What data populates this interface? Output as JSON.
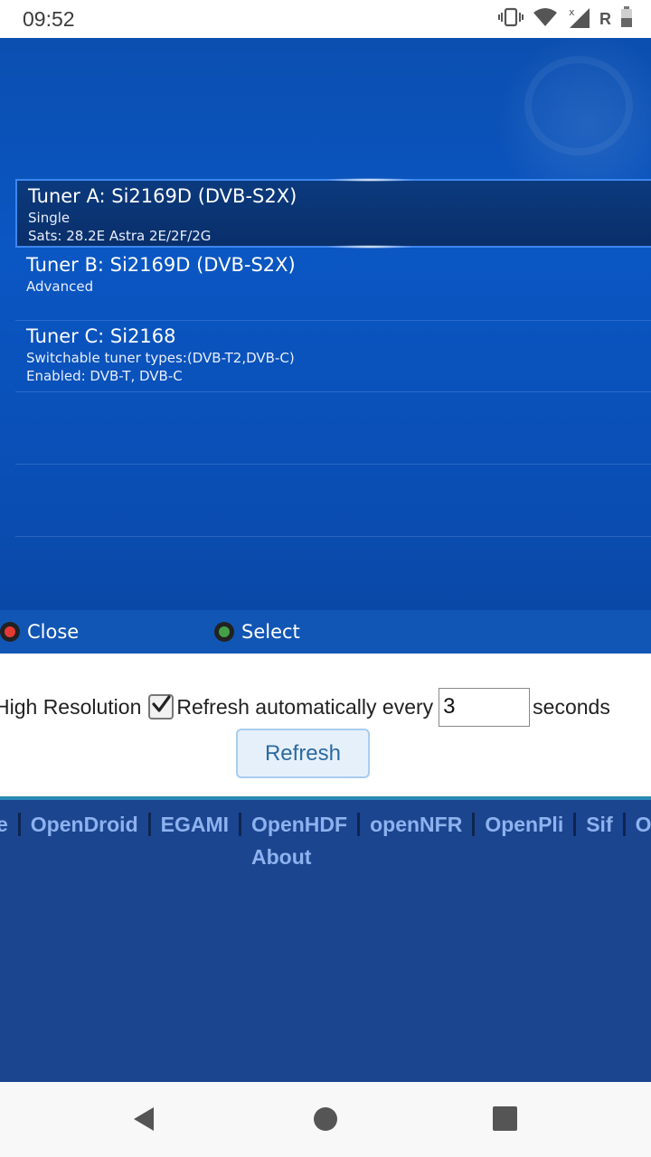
{
  "status_bar": {
    "time": "09:52",
    "roaming_label": "R",
    "icons": [
      "vibrate-icon",
      "wifi-icon",
      "cell-signal-icon",
      "battery-icon"
    ]
  },
  "tv_screen": {
    "tuners": [
      {
        "title": "Tuner A: Si2169D (DVB-S2X)",
        "line1": "Single",
        "line2": "Sats: 28.2E Astra 2E/2F/2G",
        "selected": true
      },
      {
        "title": "Tuner B: Si2169D (DVB-S2X)",
        "line1": "Advanced",
        "line2": ""
      },
      {
        "title": "Tuner C: Si2168",
        "line1": "Switchable tuner types:(DVB-T2,DVB-C)",
        "line2": "Enabled: DVB-T, DVB-C"
      }
    ],
    "buttons": {
      "close_label": "Close",
      "close_color": "#e53935",
      "select_label": "Select",
      "select_color": "#43a047"
    }
  },
  "controls": {
    "high_resolution_label": "High Resolution",
    "auto_refresh_checked": true,
    "auto_refresh_label": "Refresh automatically every",
    "interval_value": "3",
    "seconds_label": "seconds",
    "refresh_button": "Refresh"
  },
  "footer_nav": {
    "links": [
      "e",
      "OpenDroid",
      "EGAMI",
      "OpenHDF",
      "openNFR",
      "OpenPli",
      "Sif",
      "Op"
    ],
    "about": "About"
  },
  "colors": {
    "tv_background": "#0a56c3",
    "selection_border": "#3d86f0",
    "footer_background": "#1c4590",
    "footer_link": "#8db2ee",
    "refresh_button_text": "#2c6aa0"
  }
}
